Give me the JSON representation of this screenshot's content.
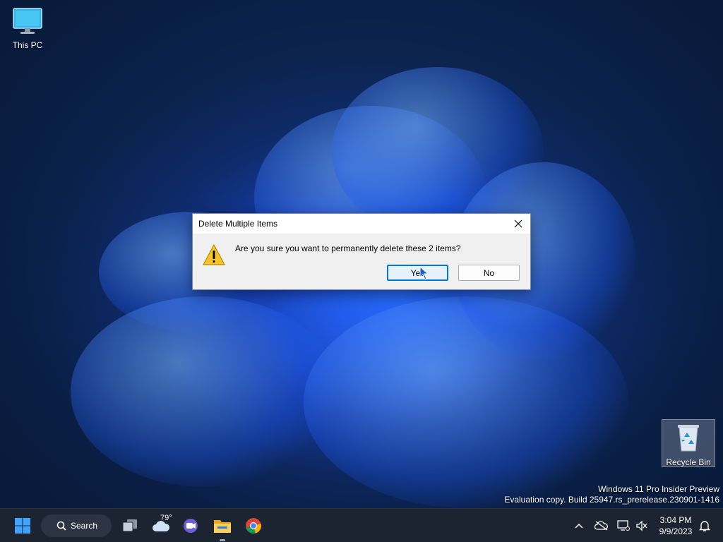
{
  "desktop": {
    "icons": {
      "this_pc": "This PC",
      "recycle_bin": "Recycle Bin"
    },
    "watermark": {
      "line1": "Windows 11 Pro Insider Preview",
      "line2": "Evaluation copy. Build 25947.rs_prerelease.230901-1416"
    }
  },
  "dialog": {
    "title": "Delete Multiple Items",
    "message": "Are you sure you want to permanently delete these 2 items?",
    "yes_label": "Yes",
    "no_label": "No",
    "close_glyph": "✕"
  },
  "taskbar": {
    "search_label": "Search",
    "weather_temp": "79°",
    "time": "3:04 PM",
    "date": "9/9/2023"
  },
  "colors": {
    "accent": "#0078d7",
    "taskbar_bg": "#1c2431",
    "warning": "#f7c52b"
  }
}
